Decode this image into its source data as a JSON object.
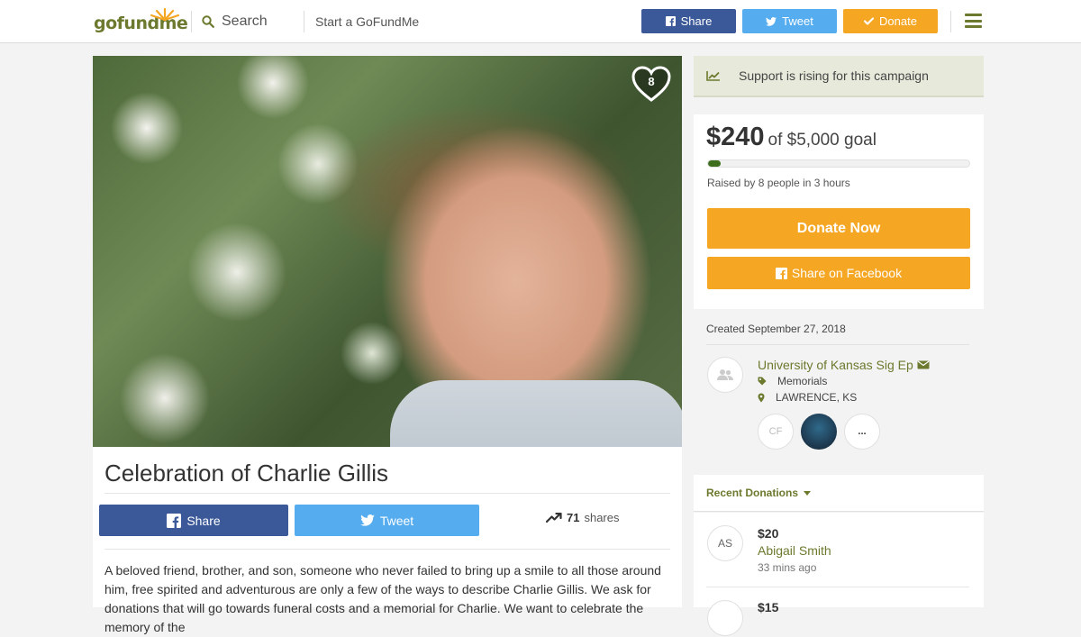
{
  "header": {
    "logo": "gofundme",
    "search_label": "Search",
    "start_label": "Start a GoFundMe",
    "share_label": "Share",
    "tweet_label": "Tweet",
    "donate_label": "Donate"
  },
  "campaign": {
    "heart_count": "8",
    "title": "Celebration of Charlie Gillis",
    "share_label": "Share",
    "tweet_label": "Tweet",
    "shares_count": "71",
    "shares_label": "shares",
    "story": "A beloved friend, brother, and son, someone who never failed to bring up a smile to all those around him, free spirited and adventurous are only a few of the ways to describe Charlie Gillis. We ask for donations that will go towards funeral costs and a memorial for Charlie. We want to celebrate the memory of the"
  },
  "sidebar": {
    "rising_text": "Support is rising for this campaign",
    "raised_amount": "$240",
    "goal_text": "of $5,000 goal",
    "progress_fraction": 0.048,
    "raised_by": "Raised by 8 people in 3 hours",
    "donate_now_label": "Donate Now",
    "share_facebook_label": "Share on Facebook",
    "created": "Created September 27, 2018",
    "organizer": "University of Kansas Sig Ep",
    "category": "Memorials",
    "location": "LAWRENCE, KS",
    "team_initials": "CF",
    "team_more": "...",
    "recent_donations_label": "Recent Donations",
    "donations": [
      {
        "initials": "AS",
        "amount": "$20",
        "name": "Abigail Smith",
        "time": "33 mins ago"
      },
      {
        "amount": "$15"
      }
    ]
  },
  "colors": {
    "brand_green": "#6b7a2e",
    "facebook_blue": "#3b5998",
    "twitter_blue": "#55acee",
    "donate_orange": "#f5a623",
    "progress_green": "#3c6e1e"
  },
  "icons": [
    "search-icon",
    "facebook-icon",
    "twitter-icon",
    "check-icon",
    "menu-icon",
    "heart-icon",
    "trending-icon",
    "chart-icon",
    "envelope-icon",
    "tag-icon",
    "location-icon",
    "group-icon",
    "caret-down-icon"
  ]
}
